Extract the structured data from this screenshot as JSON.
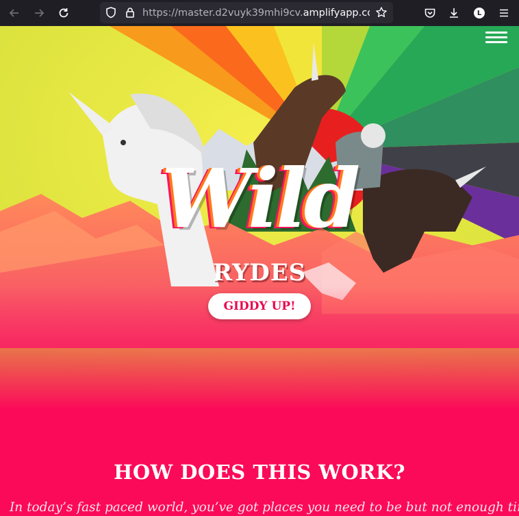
{
  "browser": {
    "url_prefix": "https://master.d2vuyk39mhi9cv.",
    "url_host": "amplifyapp.com",
    "profile_initial": "L",
    "icons": [
      "back-arrow-icon",
      "forward-arrow-icon",
      "reload-icon",
      "tracking-shield-icon",
      "lock-icon",
      "bookmark-star-icon",
      "pocket-icon",
      "download-icon",
      "account-icon",
      "app-menu-icon"
    ]
  },
  "hero": {
    "logo_wild": "Wild",
    "logo_rydes": "RYDES",
    "cta_label": "GIDDY UP!"
  },
  "section": {
    "title": "HOW DOES THIS WORK?",
    "body": "In today’s fast paced world, you’ve got places you need to be but not enough time"
  },
  "colors": {
    "chrome": "#1f1e25",
    "urlbar": "#2b2a33",
    "brand_pink": "#fb0a5a",
    "cta_text": "#e8094f"
  }
}
